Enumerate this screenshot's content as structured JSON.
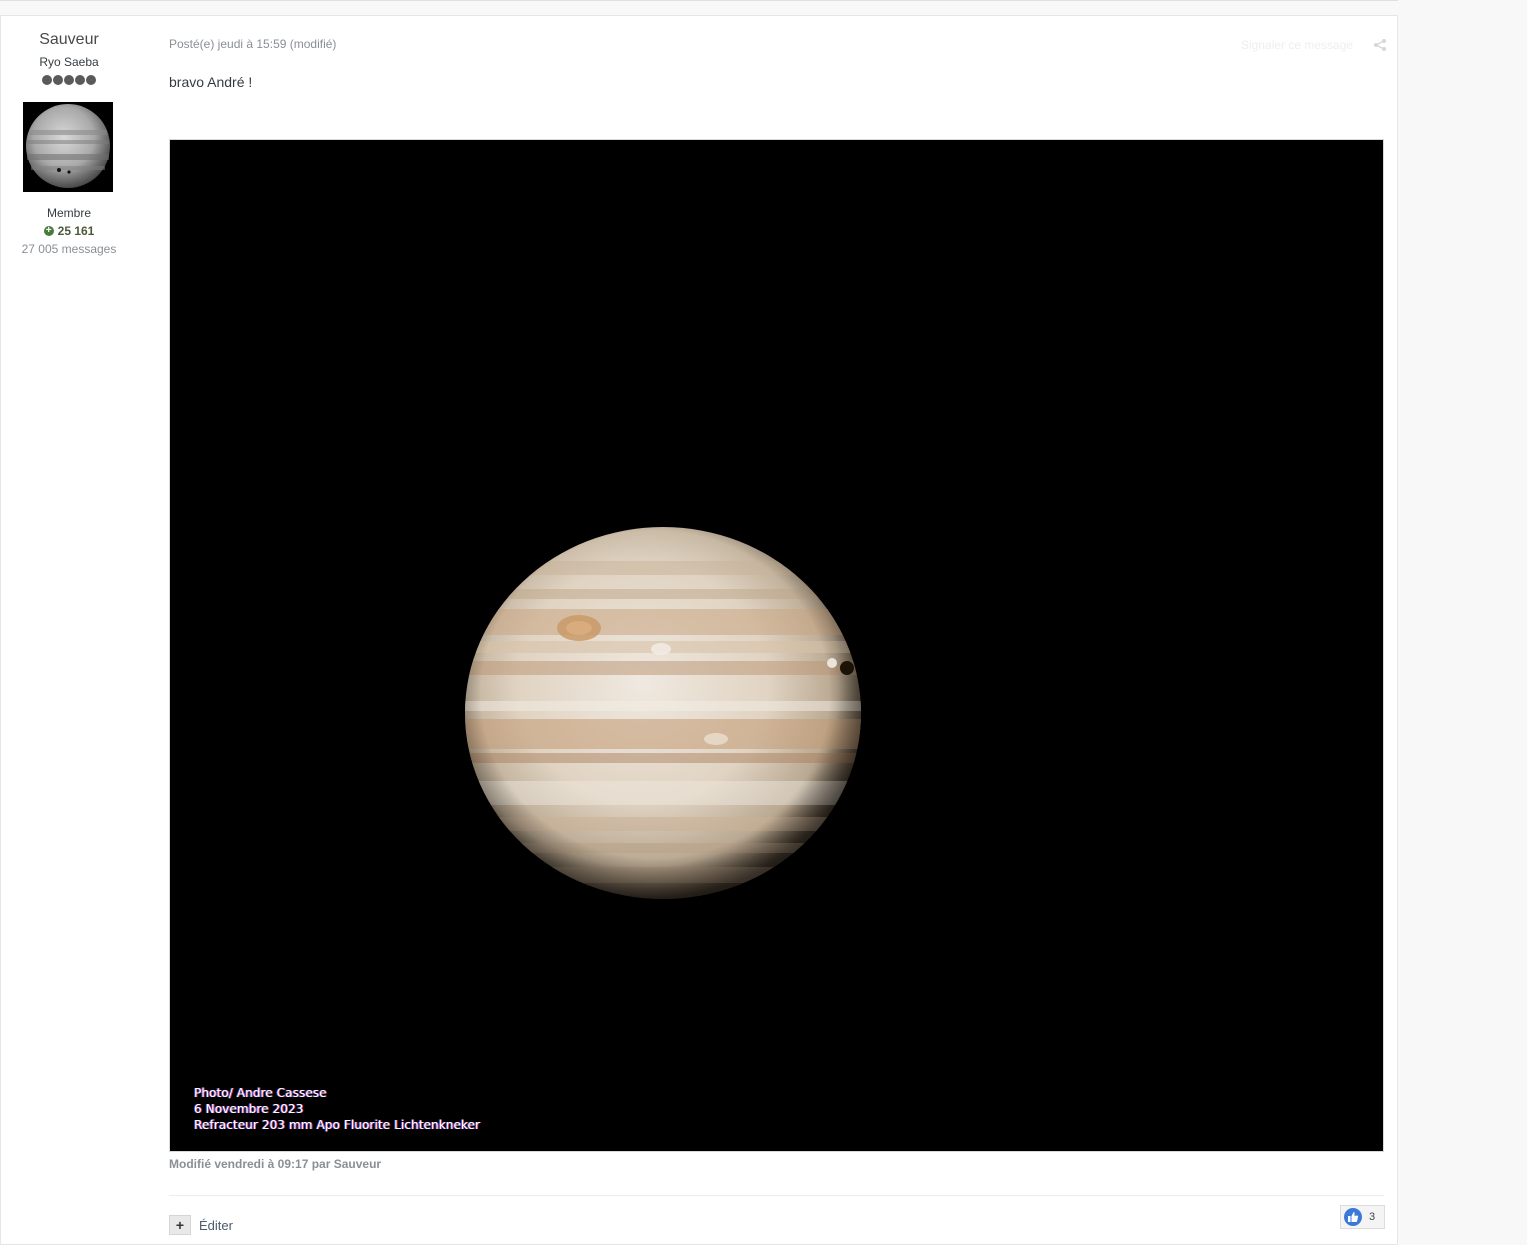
{
  "author": {
    "name": "Sauveur",
    "title": "Ryo Saeba",
    "rank_pips": 5,
    "group": "Membre",
    "reputation": "25 161",
    "post_count": "27 005 messages",
    "avatar_icon": "jupiter-avatar"
  },
  "post": {
    "meta": "Posté(e) jeudi à 15:59 (modifié)",
    "report_label": "Signaler ce message",
    "share_icon": "share-icon",
    "text": "bravo André !",
    "photo": {
      "subject": "Jupiter",
      "caption_lines": [
        "Photo/ Andre Cassese",
        "6 Novembre 2023",
        "Refracteur 203 mm Apo Fluorite Lichtenkneker"
      ]
    },
    "edited_note": "Modifié vendredi à 09:17 par Sauveur"
  },
  "actions": {
    "edit_icon": "plus-icon",
    "edit_label": "Éditer",
    "reaction_icon": "thumbs-up-icon",
    "reaction_count": "3"
  },
  "colors": {
    "accent": "#3b78d8",
    "reputation": "#4b7a3e",
    "muted": "#8a8f95"
  }
}
